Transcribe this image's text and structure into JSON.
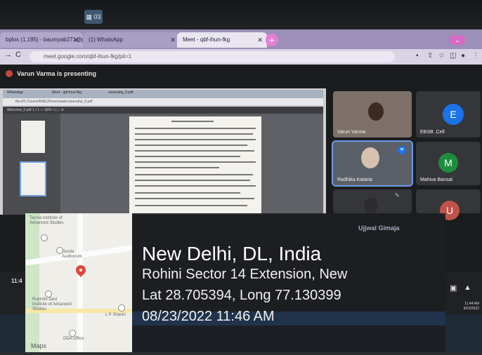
{
  "taskbar": {
    "app_label": "▦ 03"
  },
  "browser": {
    "tabs": [
      {
        "label": "bplox (1,185) - baumyab271@gm",
        "close": "✕"
      },
      {
        "label": "(1) WhatsApp",
        "close": "✕"
      },
      {
        "label": "Meet - qbf-ihun-fkg",
        "close": "✕"
      }
    ],
    "new_tab": "+",
    "url": "meet.google.com/qbf-ihun-fkg/pli=1",
    "back": "→",
    "reload": "C"
  },
  "meet": {
    "presenting": "Varun Varma is presenting",
    "shared_screen": {
      "inner_url": "file:///C:/Users/ANKU/Downloads/visarvahp_0.pdf",
      "inner_tabs": [
        "WhatsApp",
        "Meet - qbf-ihun-fkg",
        "visarvahp_0.pdf"
      ],
      "pdf_toolbar": "Welcome_0.pdf        1 / 1   —   66%   +   |   ⌂   ⟲"
    },
    "participants": [
      {
        "name": "Varun Varma"
      },
      {
        "name": "EBSB .Cell",
        "initial": "E"
      },
      {
        "name": "Radhika Kataria"
      },
      {
        "name": "Mahiva Bansal",
        "initial": "M"
      },
      {
        "name": "Ujjwal Gimaja"
      },
      {
        "name": "",
        "initial": "U"
      }
    ],
    "clock_left": "11:4",
    "tray_time": "11:44 AM",
    "tray_date": "8/23/2022"
  },
  "geo": {
    "city": "New Delhi, DL, India",
    "area": "Rohini Sector 14 Extension, New",
    "coords": "Lat 28.705394, Long 77.130399",
    "datetime": "08/23/2022 11:46 AM",
    "map_labels": {
      "tecnia": "Tecnia Institute of Advanced Studies",
      "tecnia_aud": "Tecnia Auditorium",
      "rukmini": "Rukmini Devi Institute of Advanced Studies",
      "lp_shastri": "L P Shastri",
      "dda": "DDA Office",
      "logo": "Maps"
    }
  }
}
